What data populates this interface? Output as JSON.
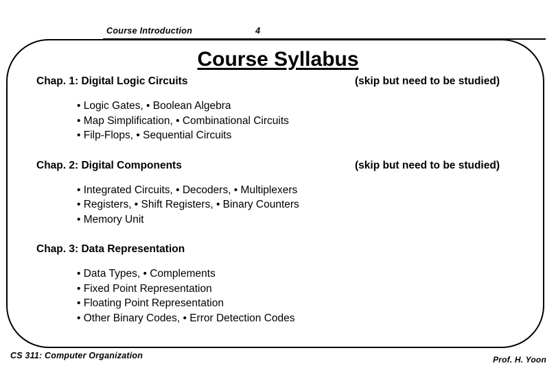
{
  "header": {
    "course_label": "Course Introduction",
    "page_number": "4"
  },
  "title": "Course Syllabus",
  "chapters": [
    {
      "heading": "Chap. 1: Digital Logic Circuits",
      "note": "(skip but need to be studied)",
      "bullets": [
        "• Logic Gates, • Boolean Algebra",
        "• Map Simplification, • Combinational Circuits",
        "• Filp-Flops, • Sequential Circuits"
      ]
    },
    {
      "heading": "Chap. 2: Digital Components",
      "note": "(skip but need to be studied)",
      "bullets": [
        "• Integrated Circuits, • Decoders, • Multiplexers",
        "• Registers, • Shift Registers, • Binary Counters",
        "• Memory Unit"
      ]
    },
    {
      "heading": "Chap. 3: Data Representation",
      "note": "",
      "bullets": [
        "• Data Types, • Complements",
        "• Fixed Point Representation",
        "• Floating Point Representation",
        "• Other Binary Codes, • Error Detection Codes"
      ]
    }
  ],
  "footer": {
    "left": "CS 311: Computer Organization",
    "right": "Prof. H. Yoon"
  },
  "colors": {
    "text": "#000000",
    "background": "#ffffff",
    "frame": "#000000"
  }
}
